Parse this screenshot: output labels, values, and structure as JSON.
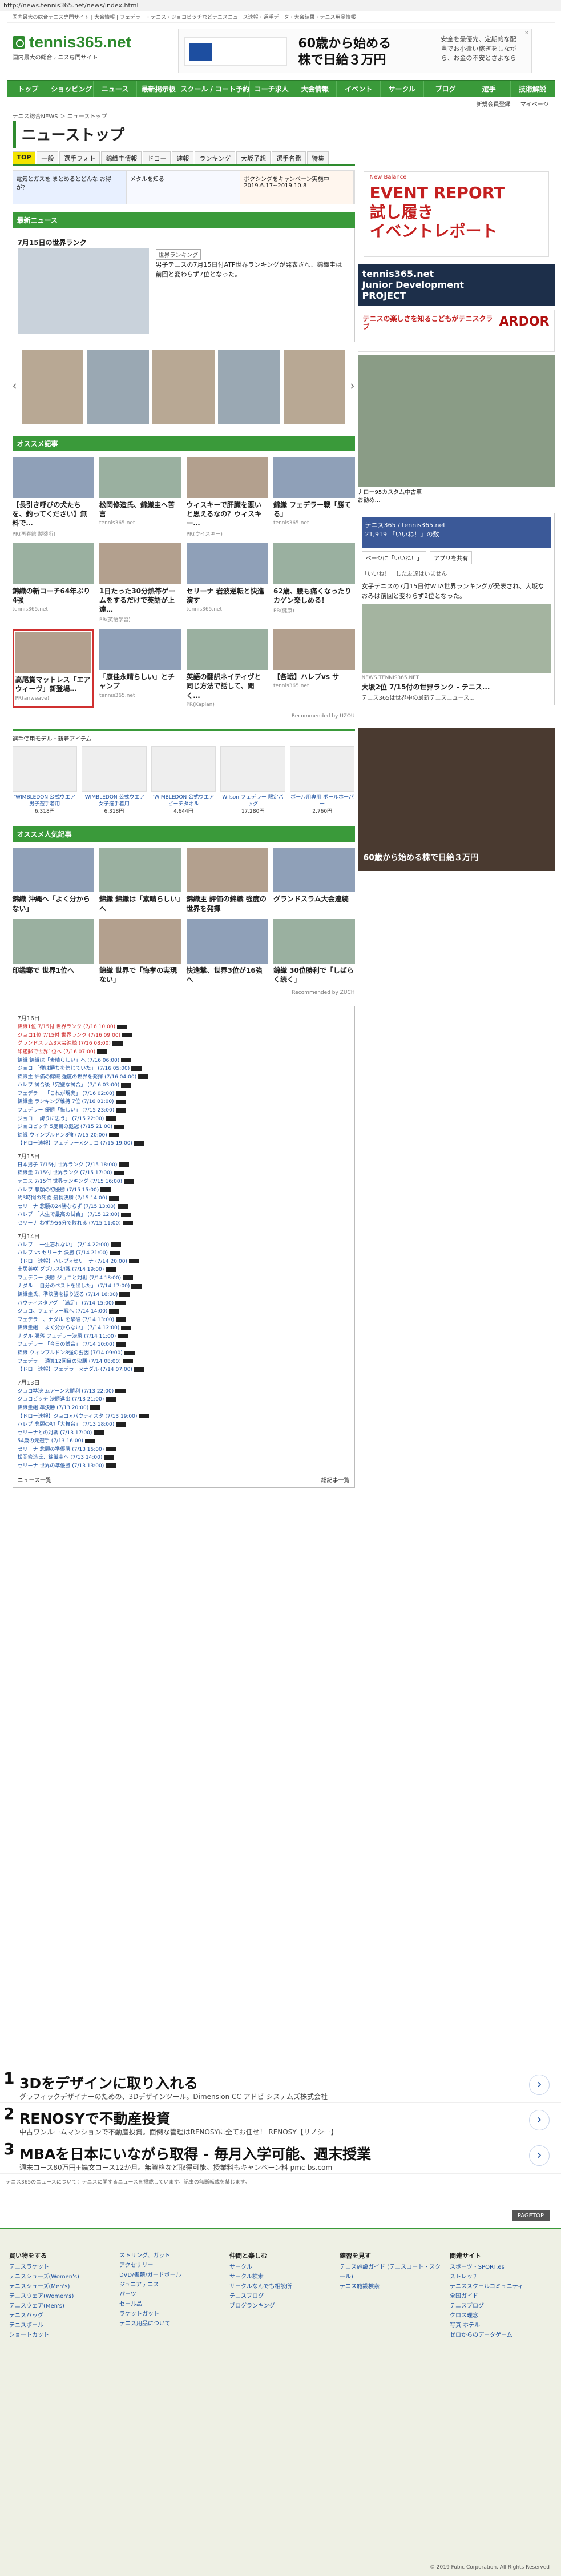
{
  "url": "http://news.tennis365.net/news/index.html",
  "top_strip": "国内最大の総合テニス専門サイト | 大会情報 | フェデラー・テニス・ジョコビッチなどテニスニュース速報・選手データ・大会結果・テニス用品情報",
  "logo": {
    "name": "tennis365.net",
    "tagline": "国内最大の総合テニス専門サイト"
  },
  "header_ad": {
    "main": "60歳から始める\n株で日給３万円",
    "sub": "安全を最優先、定期的な配当でお小遣い稼ぎをしながら、お金の不安とさよなら",
    "close": "×"
  },
  "global_nav": [
    "トップ",
    "ショッピング",
    "ニュース",
    "最新掲示板",
    "スクール / コート予約",
    "コーチ求人",
    "大会情報",
    "イベント",
    "サークル",
    "ブログ",
    "選手",
    "技術解説"
  ],
  "sub_nav": [
    "新規会員登録",
    "マイページ"
  ],
  "breadcrumb": "テニス総合NEWS ＞ ニューストップ",
  "page_title": "ニューストップ",
  "tabs": [
    "TOP",
    "一般",
    "選手フォト",
    "錦織圭情報",
    "ドロー",
    "速報",
    "ランキング",
    "大坂予想",
    "選手名鑑",
    "特集"
  ],
  "ad_strip": [
    "電気とガスを まとめるとどんな お得が？",
    "メタルを知る",
    "ボクシングをキャンペーン実施中 2019.6.17~2019.10.8"
  ],
  "latest": {
    "header": "最新ニュース",
    "title": "7月15日の世界ランク",
    "category": "世界ランキング",
    "text": "男子テニスの7月15日付ATP世界ランキングが発表され、錦織圭は前回と変わらず7位となった。"
  },
  "osusume_header": "オススメ記事",
  "articles": [
    {
      "title": "【長引き呼びの犬たちを、釣ってください】無料で…",
      "source": "PR(再春館 製薬所)"
    },
    {
      "title": "松岡修造氏、錦織圭へ苦言",
      "source": "tennis365.net"
    },
    {
      "title": "ウィスキーで肝臓を悪いと思えるなの？ウィスキー…",
      "source": "PR(ウイスキー)"
    },
    {
      "title": "錦織 フェデラー戦「勝てる」",
      "source": "tennis365.net"
    },
    {
      "title": "錦織の新コーチ64年ぶり4強",
      "source": "tennis365.net"
    },
    {
      "title": "1日たった30分熱帯ゲームをするだけで英語が上達…",
      "source": "PR(英語学習)"
    },
    {
      "title": "セリーナ 岩波逆転と快進演す",
      "source": "tennis365.net"
    },
    {
      "title": "62歳、腰も痛くなったりカゲン楽しめる！",
      "source": "PR(健康)"
    },
    {
      "title": "高尾賞マットレス「エアウィーヴ」新登場…",
      "source": "PR(airweave)"
    },
    {
      "title": "「康佳永晴らしい」とチャンプ",
      "source": "tennis365.net"
    },
    {
      "title": "英語の翻訳ネイティヴと同じ方法で話して、聞く…",
      "source": "PR(Kaplan)"
    },
    {
      "title": "【各戦】ハレプvs サ",
      "source": "tennis365.net"
    }
  ],
  "recommend": "Recommended by UZOU",
  "items": {
    "header": "選手使用モデル・新着アイテム",
    "list": [
      {
        "name": "'WIMBLEDON 公式ウエア 男子選手着用",
        "price": "6,318円"
      },
      {
        "name": "'WIMBLEDON 公式ウエア 女子選手着用",
        "price": "6,318円"
      },
      {
        "name": "'WIMBLEDON 公式ウエア ビーチタオル",
        "price": "4,644円"
      },
      {
        "name": "Wilson フェデラー 限定バッグ",
        "price": "17,280円"
      },
      {
        "name": "ボール用専用 ボールホーパー",
        "price": "2,760円"
      }
    ]
  },
  "popular": {
    "header": "オススメ人気記事",
    "list": [
      {
        "title": "錦織 沖縄へ「よく分からない」"
      },
      {
        "title": "錦織 錦織は「素晴らしい」へ"
      },
      {
        "title": "錦織主 評価の錦織 強度の世界を発揮"
      },
      {
        "title": "グランドスラム大会連続"
      },
      {
        "title": "印鑑郵で 世界1位へ"
      },
      {
        "title": "錦織 世界で「悔挙の実現ない」"
      },
      {
        "title": "快進撃、世界3位が16強へ"
      },
      {
        "title": "錦織 30位勝利で「しばらく続く」"
      }
    ],
    "recommend": "Recommended by ZUCH"
  },
  "link_groups": [
    {
      "date": "7月16日",
      "links": [
        "錦織1位 7/15付 世界ランク (7/16 10:00)",
        "ジョコ1位 7/15付 世界ランク (7/16 09:00)",
        "グランドスラム3大会連続 (7/16 08:00)",
        "印鑑郵で世界1位へ (7/16 07:00)",
        "錦織 錦織は「素晴らしい」へ (7/16 06:00)",
        "ジョコ 「僕は勝ちを信じていた」 (7/16 05:00)",
        "錦織主 評価の錦織 強度の世界を発揮 (7/16 04:00)",
        "ハレプ 試合後「完璧な試合」 (7/16 03:00)",
        "フェデラー 「これが現実」 (7/16 02:00)",
        "錦織圭 ランキング維持 7位 (7/16 01:00)",
        "フェデラー 優勝「悔しい」 (7/15 23:00)",
        "ジョコ 「誇りに思う」 (7/15 22:00)",
        "ジョコビッチ 5度目の戴冠 (7/15 21:00)",
        "錦織 ウィンブルドン8強 (7/15 20:00)",
        "【ドロー速報】フェデラー×ジョコ (7/15 19:00)"
      ]
    },
    {
      "date": "7月15日",
      "links": [
        "日本男子 7/15付 世界ランク (7/15 18:00)",
        "錦織圭 7/15付 世界ランク (7/15 17:00)",
        "テニス 7/15付 世界ランキング (7/15 16:00)",
        "ハレプ 悲願の初優勝 (7/15 15:00)",
        "約3時間の死闘 最長決勝 (7/15 14:00)",
        "セリーナ 悲願の24勝ならず (7/15 13:00)",
        "ハレプ 「人生で最高の試合」 (7/15 12:00)",
        "セリーナ わずか56分で敗れる (7/15 11:00)"
      ]
    },
    {
      "date": "7月14日",
      "links": [
        "ハレプ 「一生忘れない」 (7/14 22:00)",
        "ハレプ vs セリーナ 決勝 (7/14 21:00)",
        "【ドロー速報】ハレプ×セリーナ (7/14 20:00)",
        "土居美咲 ダブルス初戦 (7/14 19:00)",
        "フェデラー 決勝 ジョコと対戦 (7/14 18:00)",
        "ナダル 「自分のベストを出した」 (7/14 17:00)",
        "錦織圭氏、準決勝を振り返る (7/14 16:00)",
        "バウティスタアグ 「満足」 (7/14 15:00)",
        "ジョコ、フェデラー戦へ (7/14 14:00)",
        "フェデラー、ナダル を撃破 (7/14 13:00)",
        "錦織圭組 「よく分からない」 (7/14 12:00)",
        "ナダル 脱落 フェデラー決勝 (7/14 11:00)",
        "フェデラー 「今日の試合」 (7/14 10:00)",
        "錦織 ウィンブルドン8強の要因 (7/14 09:00)",
        "フェデラー 通算12回目の決勝 (7/14 08:00)",
        "【ドロー速報】フェデラー×ナダル (7/14 07:00)"
      ]
    },
    {
      "date": "7月13日",
      "links": [
        "ジョコ準決 ムアーン大勝利 (7/13 22:00)",
        "ジョコビッチ 決勝進出 (7/13 21:00)",
        "錦織圭組 準決勝 (7/13 20:00)",
        "【ドロー速報】ジョコ×バウティスタ (7/13 19:00)",
        "ハレプ 悲願の初「大舞台」 (7/13 18:00)",
        "セリーナとの対戦 (7/13 17:00)",
        "54歳の元選手 (7/13 16:00)",
        "セリーナ 悲願の準優勝 (7/13 15:00)",
        "松岡修造氏、錦織圭へ (7/13 14:00)",
        "セリーナ 世界の準優勝 (7/13 13:00)"
      ]
    }
  ],
  "link_foot": {
    "left": "ニュース一覧",
    "right": "総記事一覧"
  },
  "side": {
    "ad_big": {
      "brand": "New Balance",
      "title": "EVENT REPORT\n試し履き\nイベントレポート"
    },
    "jdp": "tennis365.net\nJunior Development\nPROJECT",
    "ardor": {
      "text": "テニスの楽しさを知るこどもがテニスクラブ",
      "brand": "ARDOR"
    },
    "photo_caption": "ナロー95カスタム中古車\nお勧め…",
    "fb": {
      "header": "テニス365 / tennis365.net",
      "likes": "21,919 「いいね！」の数",
      "btns": [
        "ページに「いいね！」",
        "アプリを共有"
      ],
      "notice": "「いいね！」した友達はいません",
      "post": "女子テニスの7月15日付WTA世界ランキングが発表され、大坂なおみは前回と変わらず2位となった。",
      "src": "NEWS.TENNIS365.NET",
      "title": "大坂2位 7/15付の世界ランク - テニス...",
      "desc": "テニス365は世界中の最新テニスニュース..."
    },
    "ad2": "60歳から始める株で日給３万円"
  },
  "bottom_ads": [
    {
      "n": "1",
      "title": "3Dをデザインに取り入れる",
      "desc": "グラフィックデザイナーのための、3Dデザインツール。Dimension CC アドビ システムズ株式会社"
    },
    {
      "n": "2",
      "title": "RENOSYで不動産投資",
      "desc": "中古ワンルームマンションで不動産投資。面倒な管理はRENOSYに全てお任せ！ RENOSY【リノシー】"
    },
    {
      "n": "3",
      "title": "MBAを日本にいながら取得 - 毎月入学可能、週末授業",
      "desc": "週末コース80万円+論文コース12か月。無資格など取得可能。授業料もキャンペーン料 pmc-bs.com"
    }
  ],
  "note": "テニス365のニュースについて：テニスに関するニュースを掲載しています。記事の無断転載を禁じます。",
  "pagetop": "PAGETOP",
  "footer": {
    "cols": [
      {
        "h": "買い物をする",
        "l": [
          "テニスラケット",
          "テニスシューズ(Women's)",
          "テニスシューズ(Men's)",
          "テニスウェア(Women's)",
          "テニスウェア(Men's)",
          "テニスバッグ",
          "テニスボール",
          "ショートカット"
        ]
      },
      {
        "h": "",
        "l": [
          "ストリング、ガット",
          "アクセサリー",
          "DVD/書籍/ガードボール",
          "ジュニアテニス",
          "パーツ",
          "セール品",
          "ラケットガット",
          "テニス用品について"
        ]
      },
      {
        "h": "仲間と楽しむ",
        "l": [
          "サークル",
          "サークル検索",
          "サークルなんでも相談所",
          "テニスブログ",
          "ブログランキング"
        ]
      },
      {
        "h": "練習を見す",
        "l": [
          "テニス施設ガイド (テニスコート・スクール)",
          "テニス施設検索"
        ]
      },
      {
        "h": "関連サイト",
        "l": [
          "スポーツ・SPORT.es",
          "ストレッチ",
          "テニススクールコミュニティ",
          "全国ガイド",
          "テニスブログ",
          "クロス理念",
          "写真 ホテル",
          "ゼロからのデータゲーム"
        ]
      }
    ],
    "copyright": "© 2019 Fubic Corporation, All Rights Reserved"
  }
}
